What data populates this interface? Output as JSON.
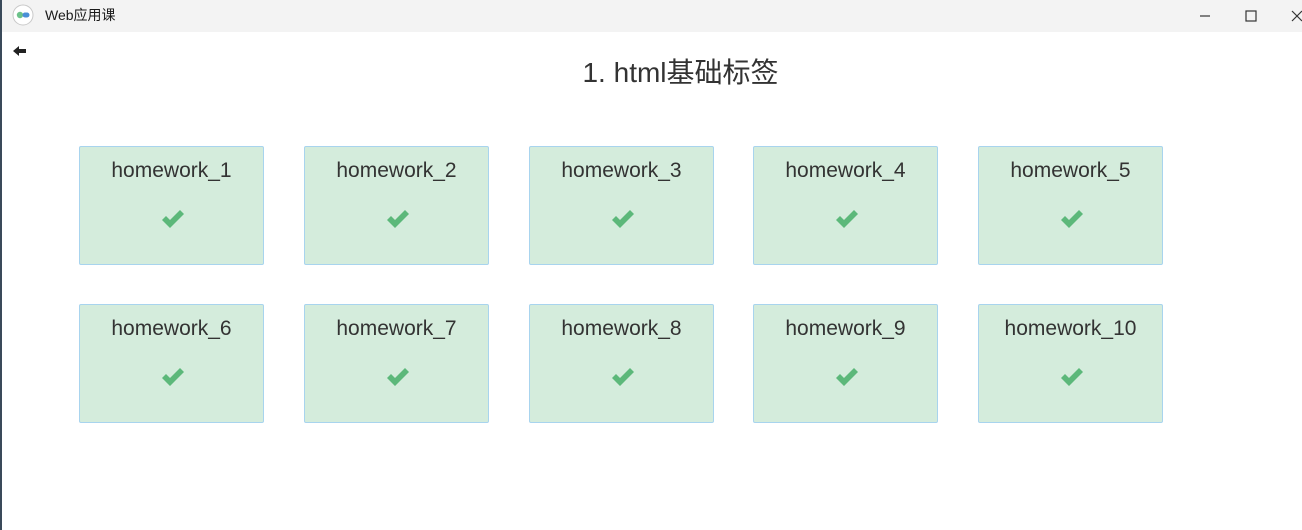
{
  "window": {
    "title": "Web应用课",
    "icon": "app-logo-icon",
    "controls": [
      "minimize-icon",
      "maximize-icon",
      "close-icon"
    ]
  },
  "nav": {
    "back_icon": "arrow-left-icon"
  },
  "page": {
    "title": "1. html基础标签"
  },
  "homeworks": [
    {
      "label": "homework_1",
      "status": "completed",
      "status_icon": "check-icon"
    },
    {
      "label": "homework_2",
      "status": "completed",
      "status_icon": "check-icon"
    },
    {
      "label": "homework_3",
      "status": "completed",
      "status_icon": "check-icon"
    },
    {
      "label": "homework_4",
      "status": "completed",
      "status_icon": "check-icon"
    },
    {
      "label": "homework_5",
      "status": "completed",
      "status_icon": "check-icon"
    },
    {
      "label": "homework_6",
      "status": "completed",
      "status_icon": "check-icon"
    },
    {
      "label": "homework_7",
      "status": "completed",
      "status_icon": "check-icon"
    },
    {
      "label": "homework_8",
      "status": "completed",
      "status_icon": "check-icon"
    },
    {
      "label": "homework_9",
      "status": "completed",
      "status_icon": "check-icon"
    },
    {
      "label": "homework_10",
      "status": "completed",
      "status_icon": "check-icon"
    }
  ],
  "colors": {
    "card_background": "#d4ecdc",
    "card_border": "#a8d4ee",
    "check": "#5cb87a",
    "title_text": "#333333"
  }
}
